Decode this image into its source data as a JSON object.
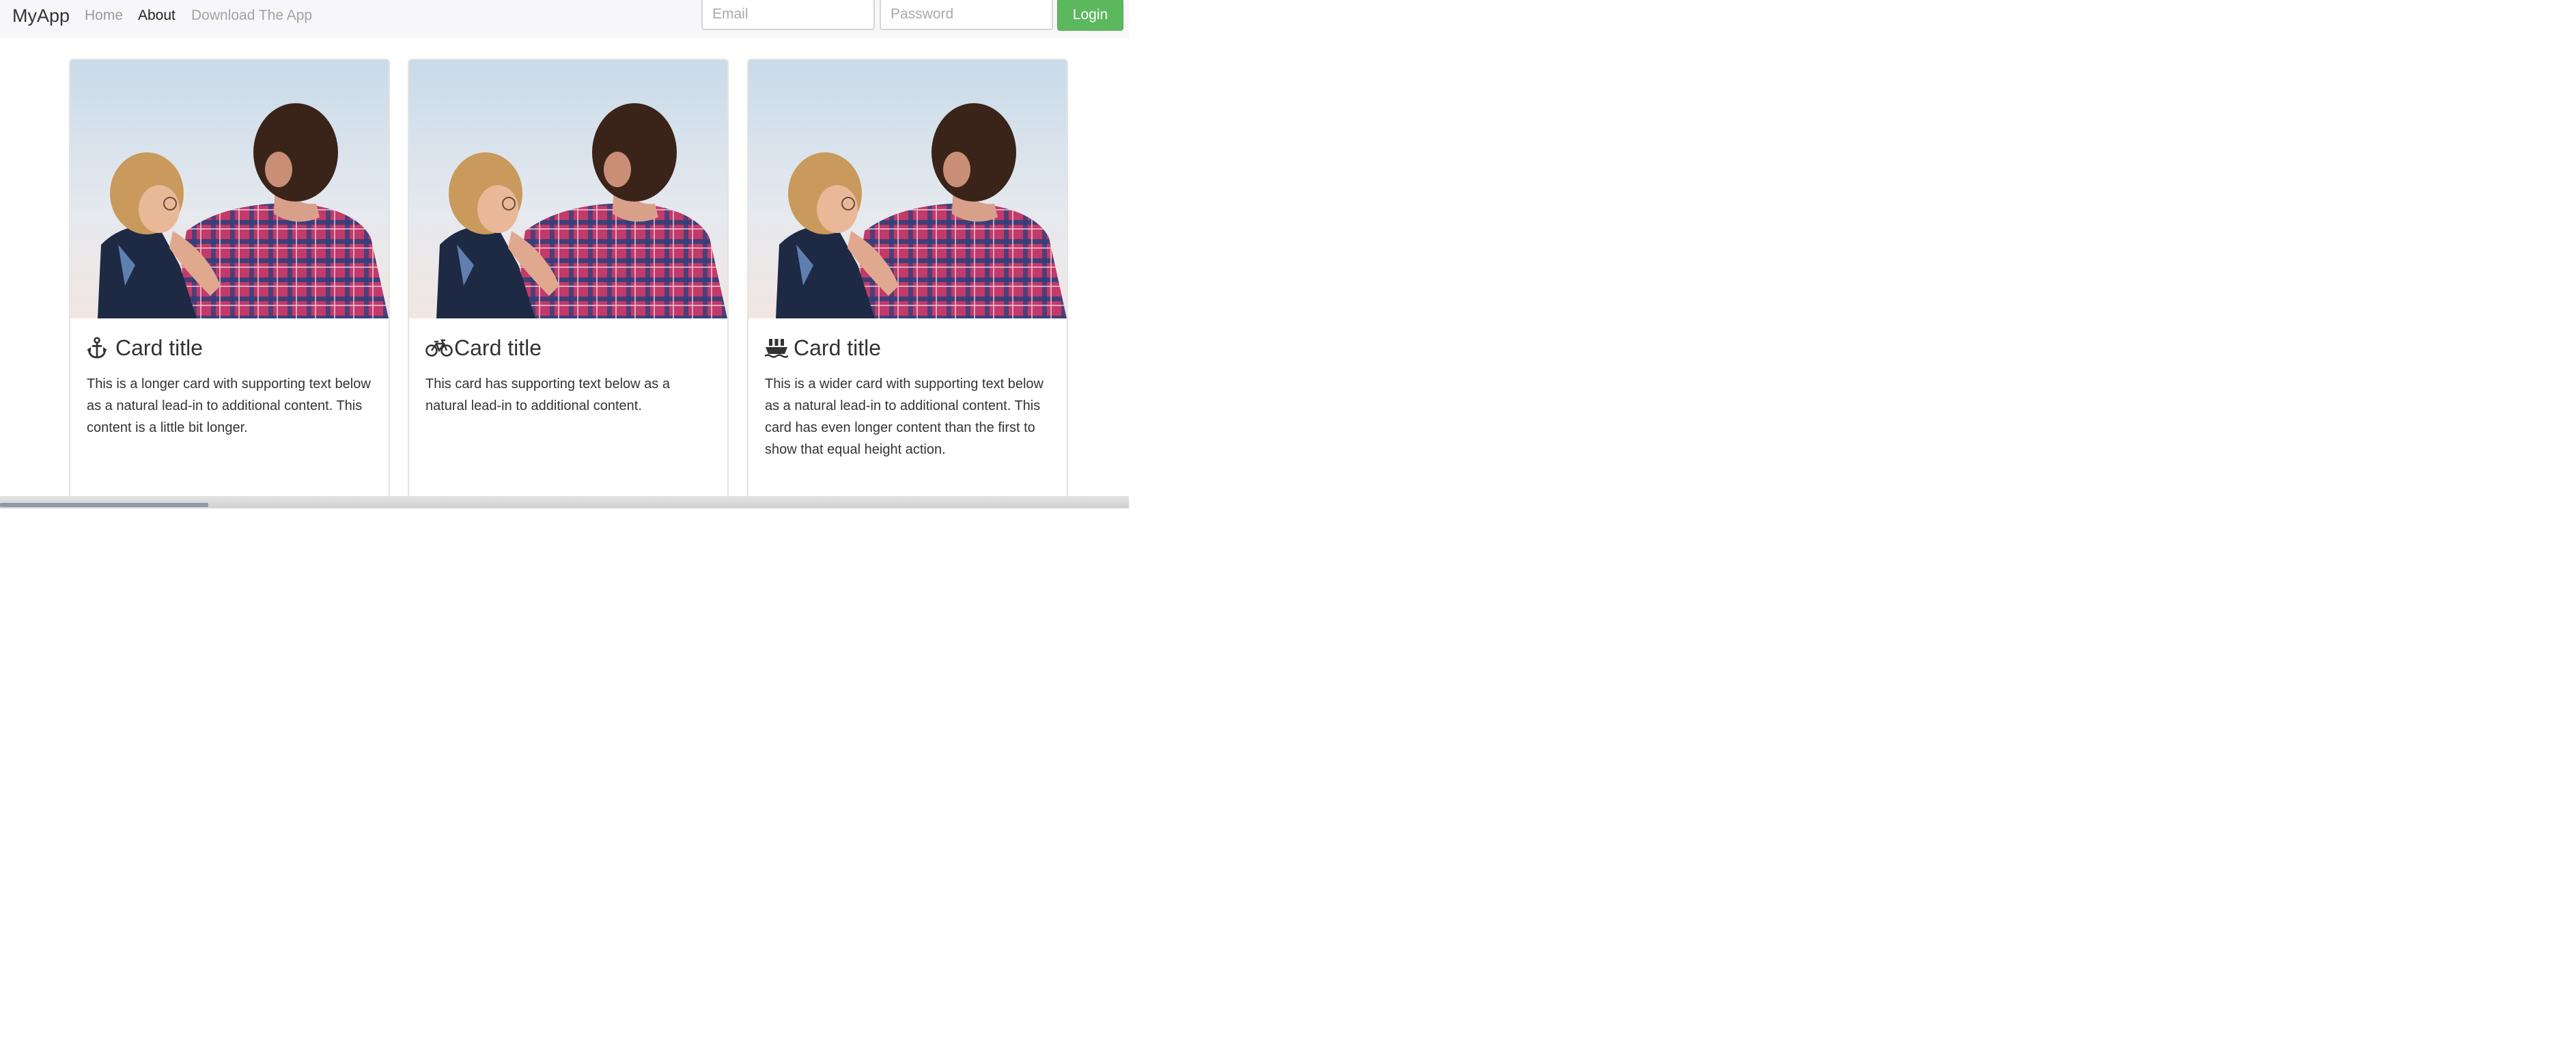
{
  "navbar": {
    "brand": "MyApp",
    "links": [
      {
        "label": "Home",
        "state": "inactive"
      },
      {
        "label": "About",
        "state": "active"
      },
      {
        "label": "Download The App",
        "state": "inactive"
      }
    ],
    "email_placeholder": "Email",
    "password_placeholder": "Password",
    "login_label": "Login",
    "login_color": "#5cb85c"
  },
  "cards": [
    {
      "icon": "anchor-icon",
      "image": "father-and-child-photo",
      "title": "Card title",
      "text": "This is a longer card with supporting text below as a natural lead-in to additional content. This content is a little bit longer."
    },
    {
      "icon": "bicycle-icon",
      "image": "father-and-child-photo",
      "title": "Card title",
      "text": "This card has supporting text below as a natural lead-in to additional content."
    },
    {
      "icon": "ship-icon",
      "image": "father-and-child-photo",
      "title": "Card title",
      "text": "This is a wider card with supporting text below as a natural lead-in to additional content. This card has even longer content than the first to show that equal height action."
    }
  ]
}
